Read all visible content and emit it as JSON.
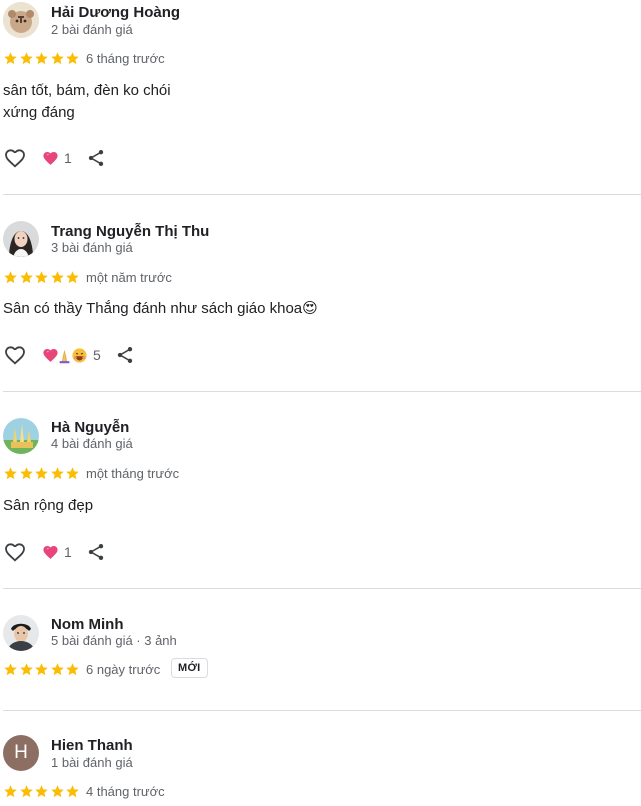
{
  "reviews": [
    {
      "name": "Hải Dương Hoàng",
      "meta": "2 bài đánh giá",
      "rating": 5,
      "time": "6 tháng trước",
      "text_lines": [
        "sân tốt, bám, đèn ko chói",
        "xứng đáng"
      ],
      "reaction_count": "1"
    },
    {
      "name": "Trang Nguyễn Thị Thu",
      "meta": "3 bài đánh giá",
      "rating": 5,
      "time": "một năm trước",
      "text_lines": [
        "Sân có thầy Thắng đánh như sách giáo khoa😍"
      ],
      "reaction_count": "5"
    },
    {
      "name": "Hà Nguyễn",
      "meta": "4 bài đánh giá",
      "rating": 5,
      "time": "một tháng trước",
      "text_lines": [
        "Sân rộng đẹp"
      ],
      "reaction_count": "1"
    },
    {
      "name": "Nom Minh",
      "meta": "5 bài đánh giá · 3 ảnh",
      "rating": 5,
      "time": "6 ngày trước",
      "badge": "MỚI"
    },
    {
      "name": "Hien Thanh",
      "meta": "1 bài đánh giá",
      "rating": 5,
      "time": "4 tháng trước",
      "avatar_letter": "H"
    }
  ],
  "colors": {
    "star": "#fbbc04",
    "heart": "#e8457a",
    "divider": "#dadce0",
    "letter_avatar": "#8d6e63"
  }
}
